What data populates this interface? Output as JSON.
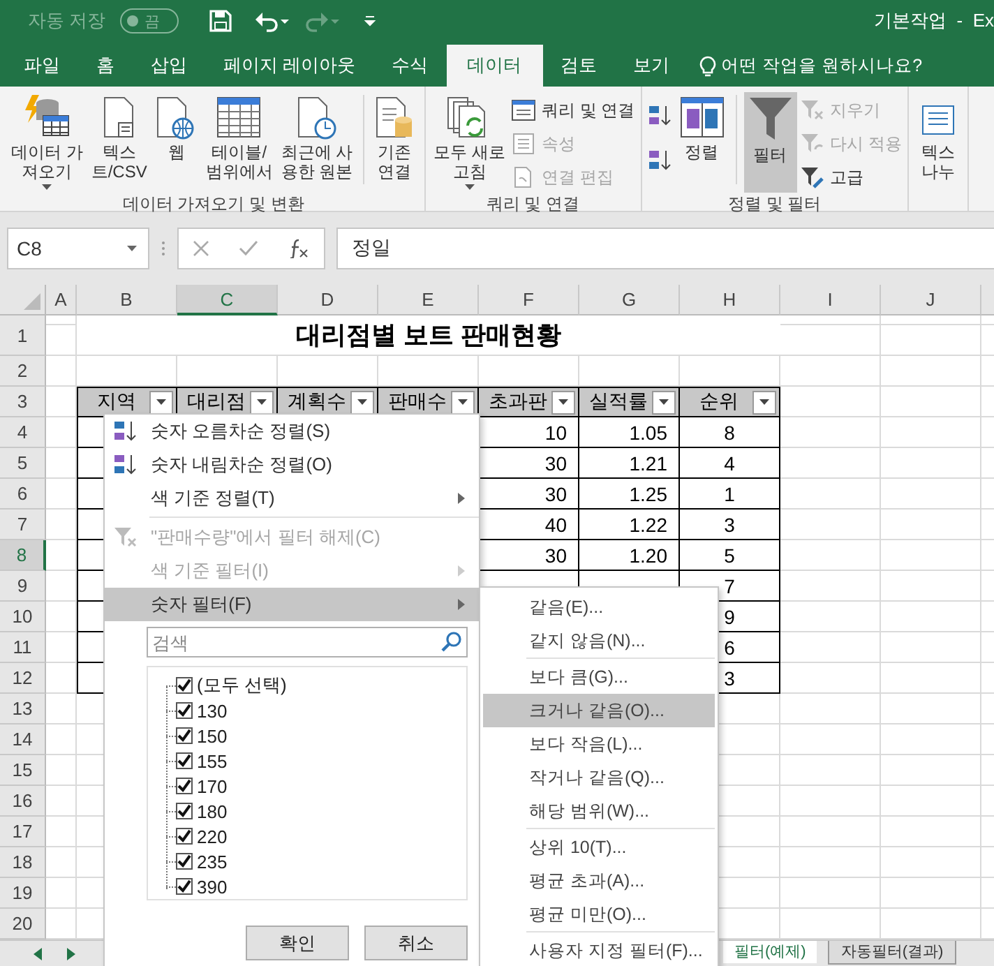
{
  "titlebar": {
    "autosave_label": "자동 저장",
    "autosave_on": false,
    "autosave_state": "끔",
    "title": "기본작업  -  Ex"
  },
  "tabs": [
    {
      "label": "파일",
      "selected": false
    },
    {
      "label": "홈",
      "selected": false
    },
    {
      "label": "삽입",
      "selected": false
    },
    {
      "label": "페이지 레이아웃",
      "selected": false
    },
    {
      "label": "수식",
      "selected": false
    },
    {
      "label": "데이터",
      "selected": true
    },
    {
      "label": "검토",
      "selected": false
    },
    {
      "label": "보기",
      "selected": false
    }
  ],
  "tell_me": "어떤 작업을 원하시나요?",
  "ribbon": {
    "groups": [
      {
        "label": "데이터 가져오기 및 변환",
        "items": [
          {
            "kind": "large",
            "label": "데이터 가\n져오기",
            "dropdown": true
          },
          {
            "kind": "large",
            "label": "텍스\n트/CSV"
          },
          {
            "kind": "large",
            "label": "웹"
          },
          {
            "kind": "large",
            "label": "테이블/\n범위에서"
          },
          {
            "kind": "large",
            "label": "최근에 사\n용한 원본"
          },
          {
            "kind": "large",
            "label": "기존\n연결",
            "divider_before": true
          }
        ]
      },
      {
        "label": "쿼리 및 연결",
        "items": [
          {
            "kind": "large",
            "label": "모두 새로\n고침",
            "dropdown": true
          },
          {
            "kind": "stack",
            "items": [
              {
                "label": "쿼리 및 연결",
                "disabled": false
              },
              {
                "label": "속성",
                "disabled": true
              },
              {
                "label": "연결 편집",
                "disabled": true
              }
            ]
          }
        ]
      },
      {
        "label": "정렬 및 필터",
        "items": [
          {
            "kind": "sort_icons"
          },
          {
            "kind": "large",
            "label": "정렬"
          },
          {
            "kind": "large",
            "label": "필터",
            "pressed": true,
            "divider_before": true
          },
          {
            "kind": "stack",
            "items": [
              {
                "label": "지우기",
                "disabled": true
              },
              {
                "label": "다시 적용",
                "disabled": true
              },
              {
                "label": "고급",
                "disabled": false
              }
            ]
          }
        ]
      },
      {
        "items": [
          {
            "kind": "large",
            "label": "텍스\n나누"
          }
        ]
      }
    ]
  },
  "formula_bar": {
    "name_box": "C8",
    "formula": "정일"
  },
  "columns": [
    {
      "label": "A",
      "selected": false
    },
    {
      "label": "B",
      "selected": false
    },
    {
      "label": "C",
      "selected": true
    },
    {
      "label": "D",
      "selected": false
    },
    {
      "label": "E",
      "selected": false
    },
    {
      "label": "F",
      "selected": false
    },
    {
      "label": "G",
      "selected": false
    },
    {
      "label": "H",
      "selected": false
    },
    {
      "label": "I",
      "selected": false
    },
    {
      "label": "J",
      "selected": false
    }
  ],
  "rows": [
    {
      "label": "1",
      "selected": false
    },
    {
      "label": "2",
      "selected": false
    },
    {
      "label": "3",
      "selected": false
    },
    {
      "label": "4",
      "selected": false
    },
    {
      "label": "5",
      "selected": false
    },
    {
      "label": "6",
      "selected": false
    },
    {
      "label": "7",
      "selected": false
    },
    {
      "label": "8",
      "selected": true
    },
    {
      "label": "9",
      "selected": false
    },
    {
      "label": "10",
      "selected": false
    },
    {
      "label": "11",
      "selected": false
    },
    {
      "label": "12",
      "selected": false
    },
    {
      "label": "13",
      "selected": false
    },
    {
      "label": "14",
      "selected": false
    },
    {
      "label": "15",
      "selected": false
    },
    {
      "label": "16",
      "selected": false
    },
    {
      "label": "17",
      "selected": false
    },
    {
      "label": "18",
      "selected": false
    },
    {
      "label": "19",
      "selected": false
    },
    {
      "label": "20",
      "selected": false
    }
  ],
  "sheet_title": "대리점별 보트 판매현황",
  "table": {
    "headers": [
      "지역",
      "대리점",
      "계획수",
      "판매수",
      "초과판",
      "실적률",
      "순위"
    ],
    "rows": [
      {
        "F": "10",
        "G": "1.05",
        "H": "8"
      },
      {
        "F": "30",
        "G": "1.21",
        "H": "4"
      },
      {
        "F": "30",
        "G": "1.25",
        "H": "1"
      },
      {
        "F": "40",
        "G": "1.22",
        "H": "3"
      },
      {
        "F": "30",
        "G": "1.20",
        "H": "5"
      },
      {
        "H": "7"
      },
      {
        "H": "9"
      },
      {
        "H": "6"
      },
      {
        "H": "3"
      }
    ]
  },
  "filter_menu": {
    "items": [
      {
        "kind": "sort_asc",
        "label": "숫자 오름차순 정렬(S)",
        "disabled": false,
        "submenu": false,
        "highlighted": false
      },
      {
        "kind": "sort_desc",
        "label": "숫자 내림차순 정렬(O)",
        "disabled": false,
        "submenu": false,
        "highlighted": false
      },
      {
        "kind": "plain",
        "label": "색 기준 정렬(T)",
        "disabled": false,
        "submenu": true,
        "highlighted": false,
        "separator_after": true
      },
      {
        "kind": "clear",
        "label": "\"판매수량\"에서 필터 해제(C)",
        "disabled": true,
        "submenu": false,
        "highlighted": false
      },
      {
        "kind": "plain",
        "label": "색 기준 필터(I)",
        "disabled": true,
        "submenu": true,
        "highlighted": false
      },
      {
        "kind": "plain",
        "label": "숫자 필터(F)",
        "disabled": false,
        "submenu": true,
        "highlighted": true
      }
    ],
    "search_placeholder": "검색",
    "values": [
      {
        "label": "(모두 선택)",
        "checked": true
      },
      {
        "label": "130",
        "checked": true
      },
      {
        "label": "150",
        "checked": true
      },
      {
        "label": "155",
        "checked": true
      },
      {
        "label": "170",
        "checked": true
      },
      {
        "label": "180",
        "checked": true
      },
      {
        "label": "220",
        "checked": true
      },
      {
        "label": "235",
        "checked": true
      },
      {
        "label": "390",
        "checked": true
      }
    ],
    "buttons": [
      "확인",
      "취소"
    ]
  },
  "number_filter_menu": [
    {
      "label": "같음(E)...",
      "highlighted": false
    },
    {
      "label": "같지 않음(N)...",
      "highlighted": false,
      "separator_after": true
    },
    {
      "label": "보다 큼(G)...",
      "highlighted": false
    },
    {
      "label": "크거나 같음(O)...",
      "highlighted": true
    },
    {
      "label": "보다 작음(L)...",
      "highlighted": false
    },
    {
      "label": "작거나 같음(Q)...",
      "highlighted": false
    },
    {
      "label": "해당 범위(W)...",
      "highlighted": false,
      "separator_after": true
    },
    {
      "label": "상위 10(T)...",
      "highlighted": false
    },
    {
      "label": "평균 초과(A)...",
      "highlighted": false
    },
    {
      "label": "평균 미만(O)...",
      "highlighted": false,
      "separator_after": true
    },
    {
      "label": "사용자 지정 필터(F)...",
      "highlighted": false
    }
  ],
  "sheet_tabs": [
    {
      "label": "필터(예제)",
      "selected": true
    },
    {
      "label": "자동필터(결과)",
      "selected": false
    }
  ]
}
